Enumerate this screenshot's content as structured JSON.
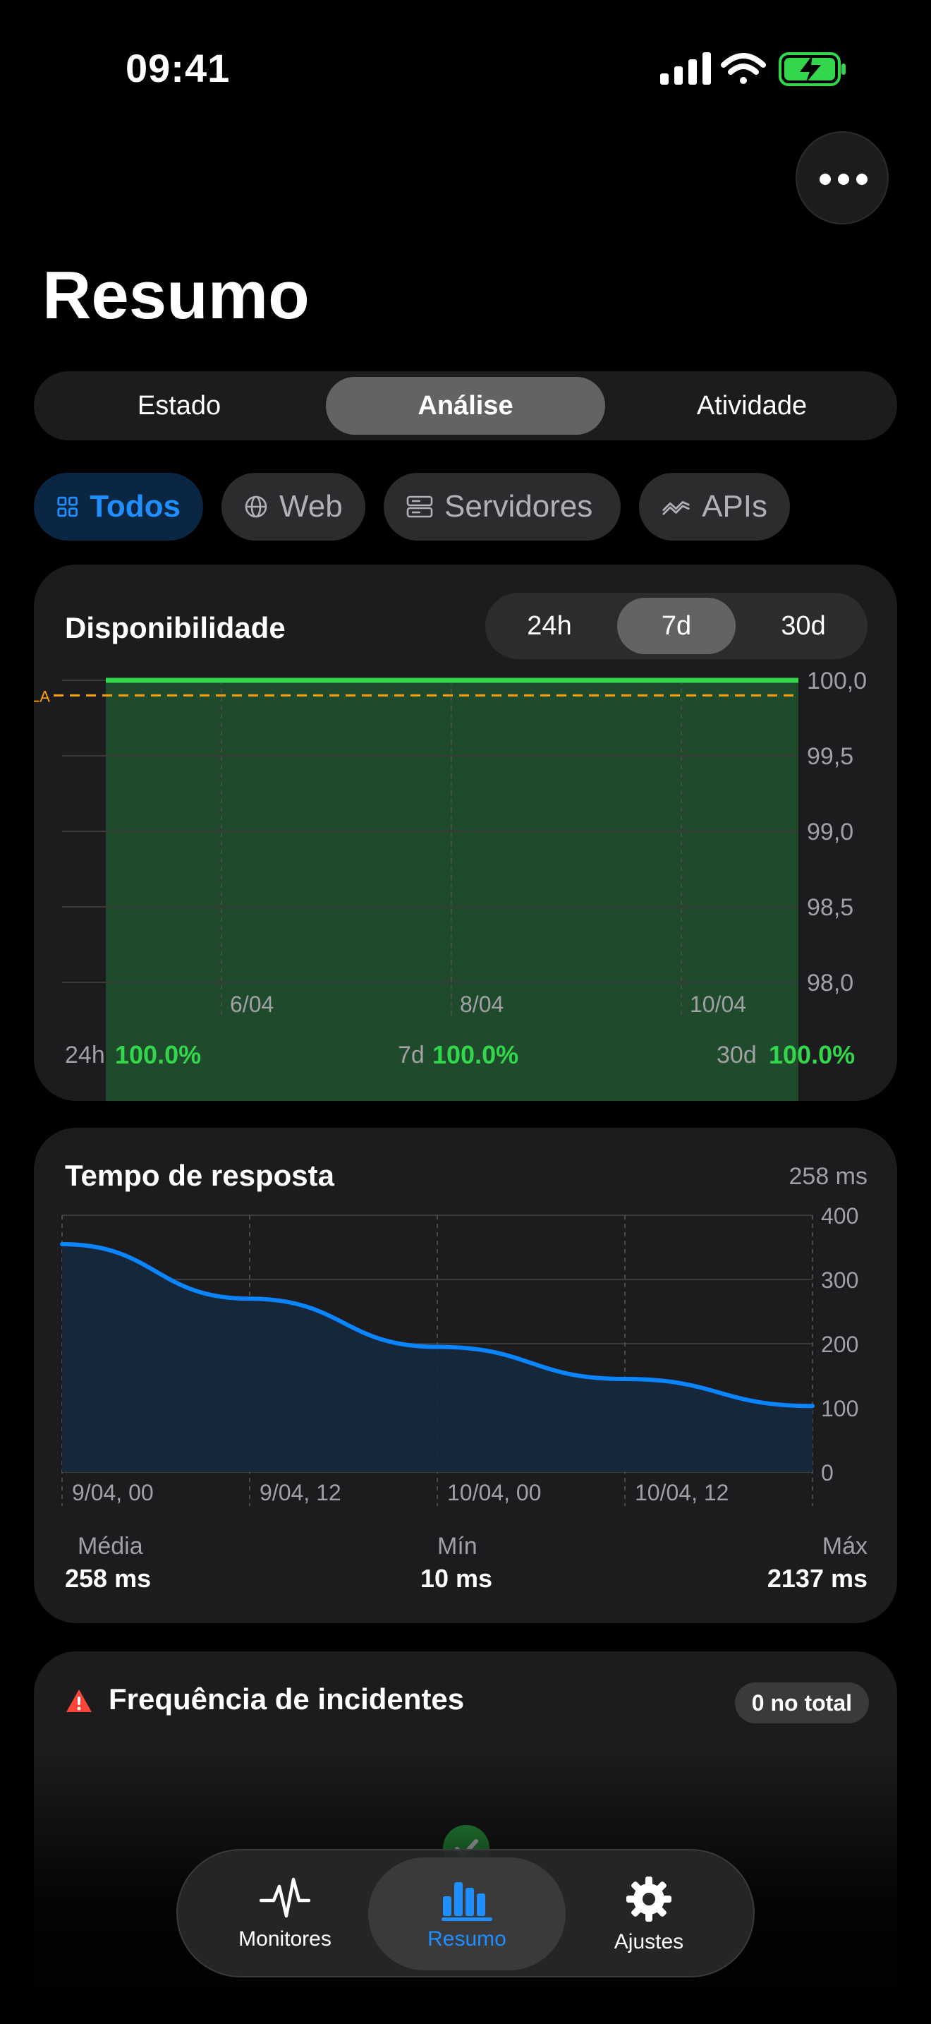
{
  "status": {
    "time": "09:41"
  },
  "page": {
    "title": "Resumo"
  },
  "segments": [
    {
      "label": "Estado",
      "active": false
    },
    {
      "label": "Análise",
      "active": true
    },
    {
      "label": "Atividade",
      "active": false
    }
  ],
  "filters": [
    {
      "label": "Todos",
      "icon": "grid-icon",
      "active": true
    },
    {
      "label": "Web",
      "icon": "globe-icon",
      "active": false
    },
    {
      "label": "Servidores",
      "icon": "server-icon",
      "active": false
    },
    {
      "label": "APIs",
      "icon": "api-icon",
      "active": false
    }
  ],
  "availability": {
    "title": "Disponibilidade",
    "ranges": [
      "24h",
      "7d",
      "30d"
    ],
    "active_range": "7d",
    "sla_label": "LA",
    "stats": [
      {
        "label": "24h",
        "value": "100.0%"
      },
      {
        "label": "7d",
        "value": "100.0%"
      },
      {
        "label": "30d",
        "value": "100.0%"
      }
    ]
  },
  "response": {
    "title": "Tempo de resposta",
    "current": "258 ms",
    "stats": [
      {
        "label": "Média",
        "value": "258 ms"
      },
      {
        "label": "Mín",
        "value": "10 ms"
      },
      {
        "label": "Máx",
        "value": "2137 ms"
      }
    ]
  },
  "incidents": {
    "title": "Frequência de incidentes",
    "badge": "0 no total"
  },
  "tabbar": [
    {
      "label": "Monitores",
      "icon": "heartbeat-icon",
      "active": false
    },
    {
      "label": "Resumo",
      "icon": "bar-chart-icon",
      "active": true
    },
    {
      "label": "Ajustes",
      "icon": "gear-icon",
      "active": false
    }
  ],
  "colors": {
    "accent": "#1e8fff",
    "green": "#32d74b",
    "sla": "#ff9f0a",
    "line": "#0a84ff"
  },
  "chart_data": [
    {
      "type": "area",
      "x": [
        "6/04",
        "8/04",
        "10/04"
      ],
      "y_ticks": [
        "100,0",
        "99,5",
        "99,0",
        "98,5",
        "98,0"
      ],
      "ylim": [
        98.0,
        100.0
      ],
      "sla": 99.9,
      "values": [
        100.0,
        100.0,
        100.0
      ],
      "grid": true
    },
    {
      "type": "area",
      "x": [
        "9/04, 00",
        "9/04, 12",
        "10/04, 00",
        "10/04, 12"
      ],
      "y_ticks": [
        "400",
        "300",
        "200",
        "100",
        "0"
      ],
      "ylim": [
        0,
        400
      ],
      "series": [
        {
          "values": [
            355,
            270,
            195,
            145,
            103
          ]
        }
      ],
      "grid": true
    }
  ]
}
